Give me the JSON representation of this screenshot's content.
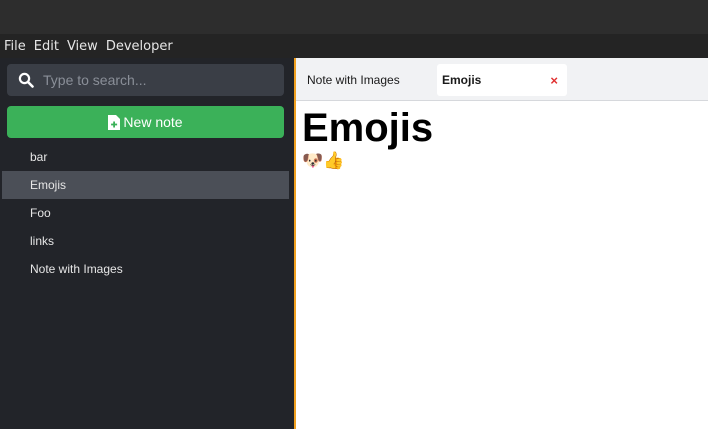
{
  "menu": [
    "File",
    "Edit",
    "View",
    "Developer"
  ],
  "search": {
    "placeholder": "Type to search..."
  },
  "new_note_label": "New note",
  "notes": [
    "bar",
    "Emojis",
    "Foo",
    "links",
    "Note with Images"
  ],
  "active_note_index": 1,
  "tabs": [
    {
      "label": "Note with Images",
      "active": false
    },
    {
      "label": "Emojis",
      "active": true,
      "close_label": "×"
    }
  ],
  "content": {
    "title": "Emojis",
    "emojis": "🐶👍"
  },
  "colors": {
    "accent_green": "#3bb159",
    "active_border": "#f0a020",
    "close_red": "#e03030"
  },
  "icons": [
    "search-icon",
    "new-note-icon",
    "close-icon"
  ]
}
